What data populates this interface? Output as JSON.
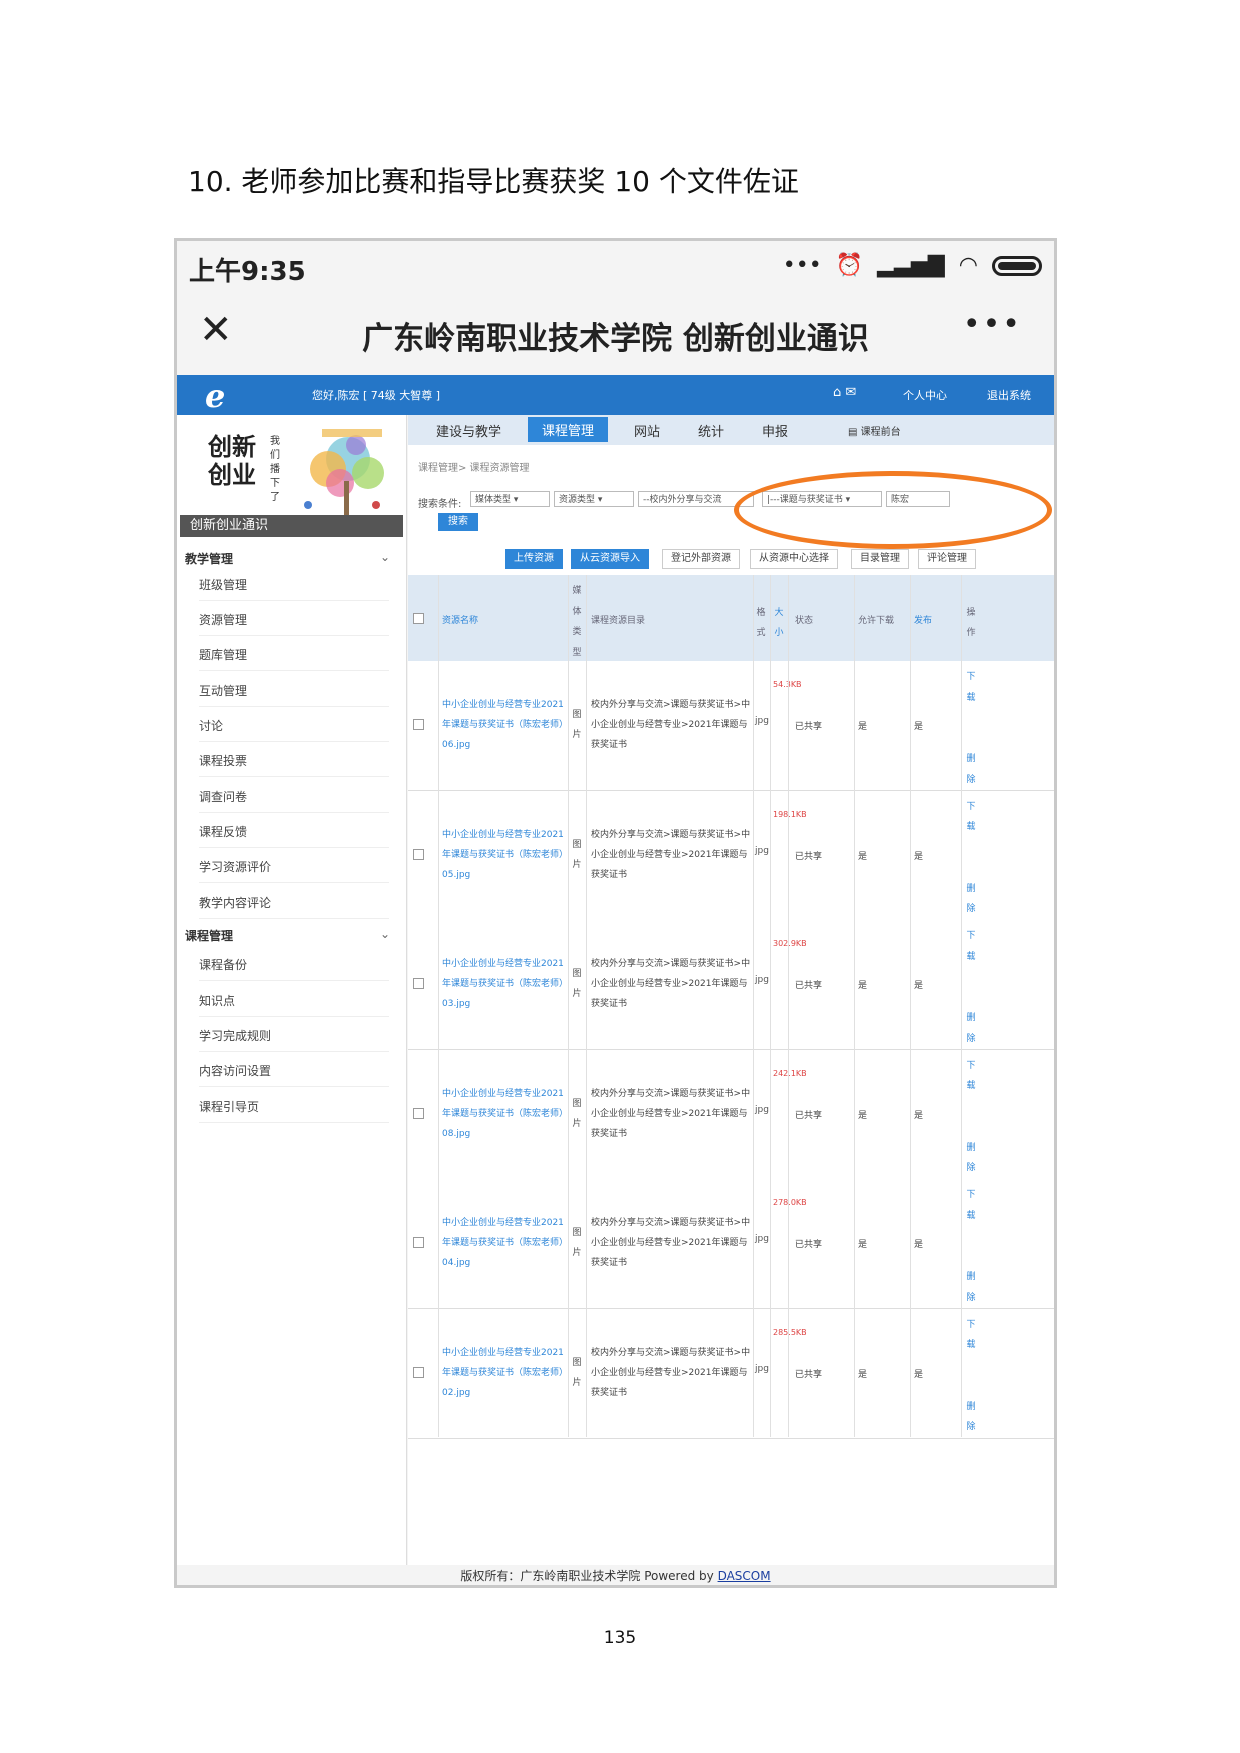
{
  "document": {
    "heading": "10. 老师参加比赛和指导比赛获奖 10 个文件佐证",
    "page_number": "135"
  },
  "status_bar": {
    "time": "上午9:35",
    "icons": [
      "more-dots-icon",
      "alarm-icon",
      "signal-icon",
      "wifi-icon",
      "battery-icon"
    ]
  },
  "title_bar": {
    "close": "✕",
    "title": "广东岭南职业技术学院 创新创业通识",
    "more": "•••"
  },
  "header": {
    "logo": "e",
    "greeting": "您好,陈宏 [ 74级 大智尊 ]",
    "icons": "⌂ ✉",
    "personal_center": "个人中心",
    "logout": "退出系统",
    "color": "#2576c7"
  },
  "sidebar": {
    "brand_big": "创新\n创业",
    "brand_small": "我们播下了",
    "brand_caption": "创新创业通识",
    "section1": "教学管理",
    "items1": [
      "班级管理",
      "资源管理",
      "题库管理",
      "互动管理",
      "讨论",
      "课程投票",
      "调查问卷",
      "课程反馈",
      "学习资源评价",
      "教学内容评论"
    ],
    "section2": "课程管理",
    "items2": [
      "课程备份",
      "知识点",
      "学习完成规则",
      "内容访问设置",
      "课程引导页"
    ]
  },
  "nav": {
    "tabs": [
      "建设与教学",
      "课程管理",
      "网站",
      "统计",
      "申报"
    ],
    "active": "课程管理",
    "front": "▤ 课程前台"
  },
  "breadcrumb": "课程管理> 课程资源管理",
  "search": {
    "label": "搜索条件:",
    "media_type": "媒体类型",
    "resource_type": "资源类型",
    "dir1": "--校内外分享与交流",
    "dir2": "|---课题与获奖证书",
    "keyword": "陈宏",
    "button": "搜索"
  },
  "actions": {
    "upload": "上传资源",
    "cloud_import": "从云资源导入",
    "register_external": "登记外部资源",
    "from_center": "从资源中心选择",
    "dir_manage": "目录管理",
    "comment_manage": "评论管理"
  },
  "table": {
    "headers": {
      "name": "资源名称",
      "media": "媒体类型",
      "dir": "课程资源目录",
      "format": "格式",
      "size": "大小",
      "status": "状态",
      "allow": "允许下载",
      "publish": "发布",
      "op": "操作"
    },
    "rows": [
      {
        "name": "中小企业创业与经营专业2021年课题与获奖证书（陈宏老师）06.jpg",
        "media": "图片",
        "dir": "校内外分享与交流>课题与获奖证书>中小企业创业与经营专业>2021年课题与获奖证书",
        "format": "jpg",
        "size": "54.3KB",
        "status": "已共享",
        "allow": "是",
        "publish": "是",
        "download": "下载",
        "delete": "删除"
      },
      {
        "name": "中小企业创业与经营专业2021年课题与获奖证书（陈宏老师）05.jpg",
        "media": "图片",
        "dir": "校内外分享与交流>课题与获奖证书>中小企业创业与经营专业>2021年课题与获奖证书",
        "format": "jpg",
        "size": "198.1KB",
        "status": "已共享",
        "allow": "是",
        "publish": "是",
        "download": "下载",
        "delete": "删除"
      },
      {
        "name": "中小企业创业与经营专业2021年课题与获奖证书（陈宏老师）03.jpg",
        "media": "图片",
        "dir": "校内外分享与交流>课题与获奖证书>中小企业创业与经营专业>2021年课题与获奖证书",
        "format": "jpg",
        "size": "302.9KB",
        "status": "已共享",
        "allow": "是",
        "publish": "是",
        "download": "下载",
        "delete": "删除"
      },
      {
        "name": "中小企业创业与经营专业2021年课题与获奖证书（陈宏老师）08.jpg",
        "media": "图片",
        "dir": "校内外分享与交流>课题与获奖证书>中小企业创业与经营专业>2021年课题与获奖证书",
        "format": "jpg",
        "size": "242.1KB",
        "status": "已共享",
        "allow": "是",
        "publish": "是",
        "download": "下载",
        "delete": "删除"
      },
      {
        "name": "中小企业创业与经营专业2021年课题与获奖证书（陈宏老师）04.jpg",
        "media": "图片",
        "dir": "校内外分享与交流>课题与获奖证书>中小企业创业与经营专业>2021年课题与获奖证书",
        "format": "jpg",
        "size": "278.0KB",
        "status": "已共享",
        "allow": "是",
        "publish": "是",
        "download": "下载",
        "delete": "删除"
      },
      {
        "name": "中小企业创业与经营专业2021年课题与获奖证书（陈宏老师）02.jpg",
        "media": "图片",
        "dir": "校内外分享与交流>课题与获奖证书>中小企业创业与经营专业>2021年课题与获奖证书",
        "format": "jpg",
        "size": "285.5KB",
        "status": "已共享",
        "allow": "是",
        "publish": "是",
        "download": "下载",
        "delete": "删除"
      }
    ]
  },
  "footer": {
    "text": "版权所有：广东岭南职业技术学院 Powered by ",
    "brand": "DASCOM"
  },
  "colors": {
    "accent": "#2e86d8",
    "annotation": "#f27b22"
  }
}
